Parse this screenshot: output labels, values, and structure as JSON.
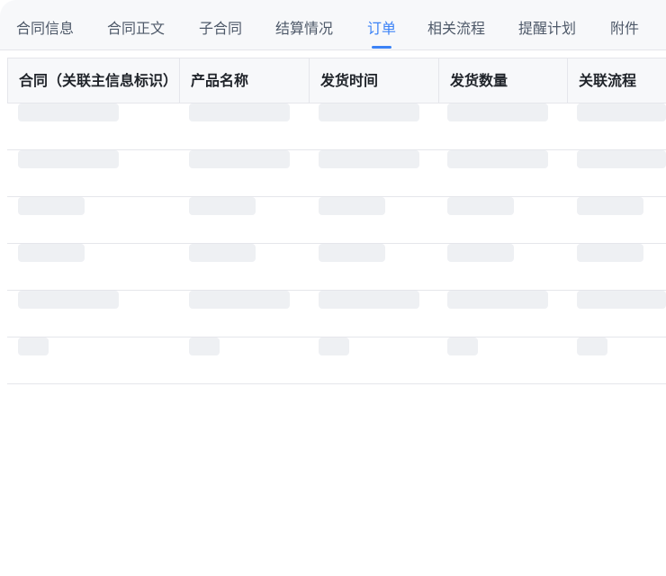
{
  "tabs": [
    {
      "label": "合同信息",
      "active": false
    },
    {
      "label": "合同正文",
      "active": false
    },
    {
      "label": "子合同",
      "active": false
    },
    {
      "label": "结算情况",
      "active": false
    },
    {
      "label": "订单",
      "active": true
    },
    {
      "label": "相关流程",
      "active": false
    },
    {
      "label": "提醒计划",
      "active": false
    },
    {
      "label": "附件",
      "active": false
    }
  ],
  "table": {
    "columns": [
      {
        "label": "合同（关联主信息标识）"
      },
      {
        "label": "产品名称"
      },
      {
        "label": "发货时间"
      },
      {
        "label": "发货数量"
      },
      {
        "label": "关联流程"
      }
    ],
    "loading": true,
    "skeleton_rows": 6
  },
  "colors": {
    "accent": "#3b82f6",
    "tab_text": "#4e5969",
    "header_bg": "#f7f8fa",
    "border": "#e5e6eb",
    "skeleton": "#eef0f3"
  }
}
